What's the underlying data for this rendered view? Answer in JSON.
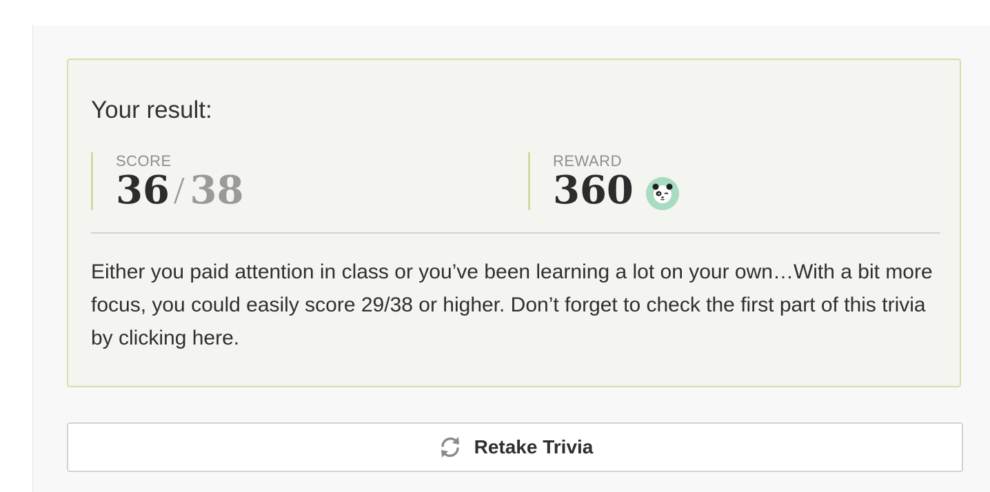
{
  "result": {
    "title": "Your result:",
    "score": {
      "label": "SCORE",
      "value": "36",
      "separator": "/",
      "total": "38"
    },
    "reward": {
      "label": "REWARD",
      "value": "360",
      "icon": "panda-icon"
    },
    "message": "Either you paid attention in class or you’ve been learning a lot on your own…With a bit more focus, you could easily score 29/38 or higher. Don’t forget to check the first part of this trivia by clicking here."
  },
  "actions": {
    "retake_label": "Retake Trivia",
    "retake_icon": "refresh-icon"
  },
  "colors": {
    "card_background": "#f4f5f0",
    "card_border": "#d3e0a6",
    "accent_bar": "#cfdc9c",
    "panda_badge": "#a8dcc0"
  }
}
